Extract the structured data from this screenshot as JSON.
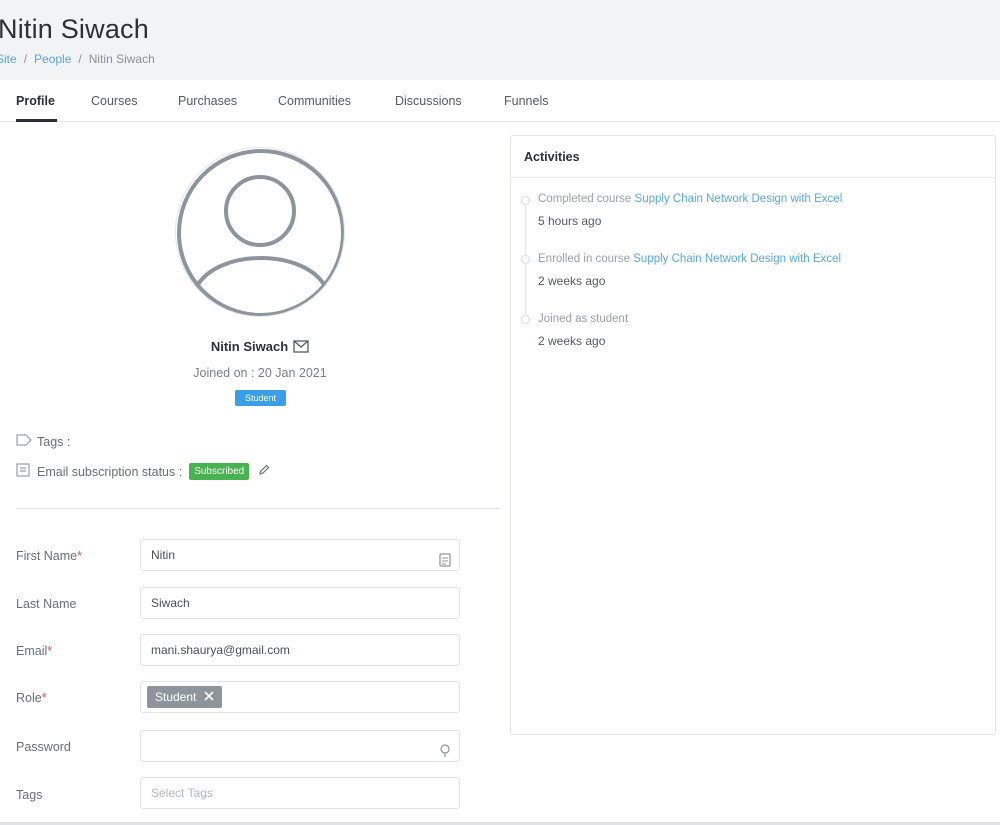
{
  "header": {
    "title": "Nitin Siwach",
    "breadcrumb": {
      "site": "Site",
      "people": "People",
      "current": "Nitin Siwach",
      "separator": "/"
    }
  },
  "tabs": [
    "Profile",
    "Courses",
    "Purchases",
    "Communities",
    "Discussions",
    "Funnels"
  ],
  "active_tab": "Profile",
  "profile": {
    "name": "Nitin Siwach",
    "joined": "Joined on : 20 Jan 2021",
    "role_badge": "Student",
    "tags_label": "Tags :",
    "email_status_label": "Email subscription status :",
    "email_status": "Subscribed",
    "avatar_icon": "user-avatar-icon",
    "colors": {
      "role_badge": "#3a9ee8",
      "subscribed": "#47b24f",
      "link": "#5aa7dc"
    }
  },
  "form": {
    "first_name": {
      "label": "First Name",
      "value": "Nitin",
      "required": "*"
    },
    "last_name": {
      "label": "Last Name",
      "value": "Siwach"
    },
    "email": {
      "label": "Email",
      "value": "mani.shaurya@gmail.com",
      "required": "*"
    },
    "role": {
      "label": "Role",
      "value": "Student",
      "required": "*"
    },
    "password": {
      "label": "Password",
      "value": ""
    },
    "tags": {
      "label": "Tags",
      "placeholder": "Select Tags"
    }
  },
  "activities": {
    "title": "Activities",
    "items": [
      {
        "text": "Completed course",
        "link": "Supply Chain Network Design with Excel",
        "time": "5 hours ago"
      },
      {
        "text": "Enrolled in course",
        "link": "Supply Chain Network Design with Excel",
        "time": "2 weeks ago"
      },
      {
        "text": "Joined as student",
        "link": "",
        "time": "2 weeks ago"
      }
    ]
  }
}
